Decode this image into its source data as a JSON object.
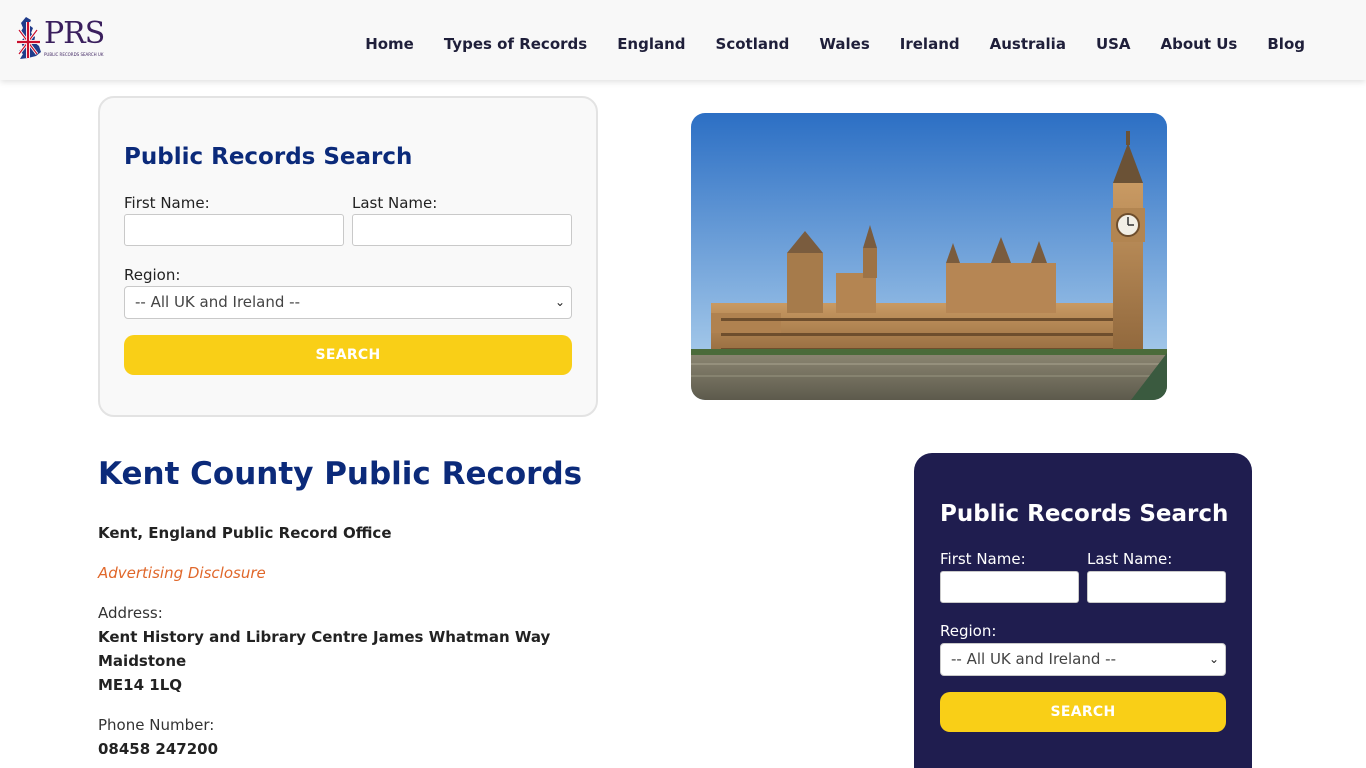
{
  "brand": {
    "logo_text": "PRS",
    "logo_subtext": "PUBLIC RECORDS SEARCH UK"
  },
  "nav": {
    "items": [
      "Home",
      "Types of Records",
      "England",
      "Scotland",
      "Wales",
      "Ireland",
      "Australia",
      "USA",
      "About Us",
      "Blog"
    ]
  },
  "search_top": {
    "title": "Public Records Search",
    "first_name_label": "First Name:",
    "last_name_label": "Last Name:",
    "first_name_value": "",
    "last_name_value": "",
    "region_label": "Region:",
    "region_selected": "-- All UK and Ireland --",
    "button_label": "SEARCH"
  },
  "hero": {
    "icon": "houses-of-parliament-photo"
  },
  "content": {
    "title": "Kent County Public Records",
    "office": "Kent, England Public Record Office",
    "disclosure": "Advertising Disclosure",
    "address_label": "Address:",
    "address_lines": [
      "Kent History and Library Centre James Whatman Way",
      "Maidstone",
      "ME14 1LQ"
    ],
    "phone_label": "Phone Number:",
    "phone": "08458 247200"
  },
  "search_side": {
    "title": "Public Records Search",
    "first_name_label": "First Name:",
    "last_name_label": "Last Name:",
    "first_name_value": "",
    "last_name_value": "",
    "region_label": "Region:",
    "region_selected": "-- All UK and Ireland --",
    "button_label": "SEARCH"
  },
  "colors": {
    "accent_navy": "#0b2a7a",
    "button_yellow": "#f9cf17",
    "sidebar_bg": "#1f1d4f",
    "disclosure_orange": "#e0672a"
  }
}
